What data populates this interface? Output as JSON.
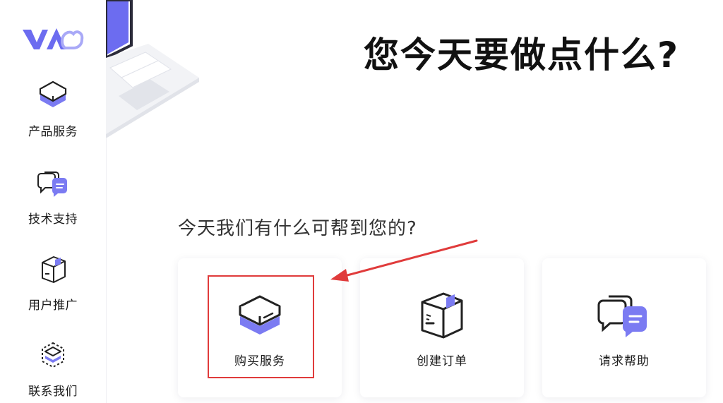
{
  "brand": {
    "accent": "#6c6cf0",
    "accent_light": "#a9a9f7",
    "annotation_red": "#e03b3b"
  },
  "sidebar": {
    "items": [
      {
        "label": "产品服务",
        "icon": "server-box-icon"
      },
      {
        "label": "技术支持",
        "icon": "chat-bubbles-icon"
      },
      {
        "label": "用户推广",
        "icon": "package-box-icon"
      },
      {
        "label": "联系我们",
        "icon": "layers-icon"
      }
    ]
  },
  "main": {
    "title": "您今天要做点什么?",
    "subtitle": "今天我们有什么可帮到您的?",
    "cards": [
      {
        "label": "购买服务",
        "icon": "server-box-icon"
      },
      {
        "label": "创建订单",
        "icon": "package-box-icon"
      },
      {
        "label": "请求帮助",
        "icon": "chat-bubbles-icon"
      }
    ]
  }
}
